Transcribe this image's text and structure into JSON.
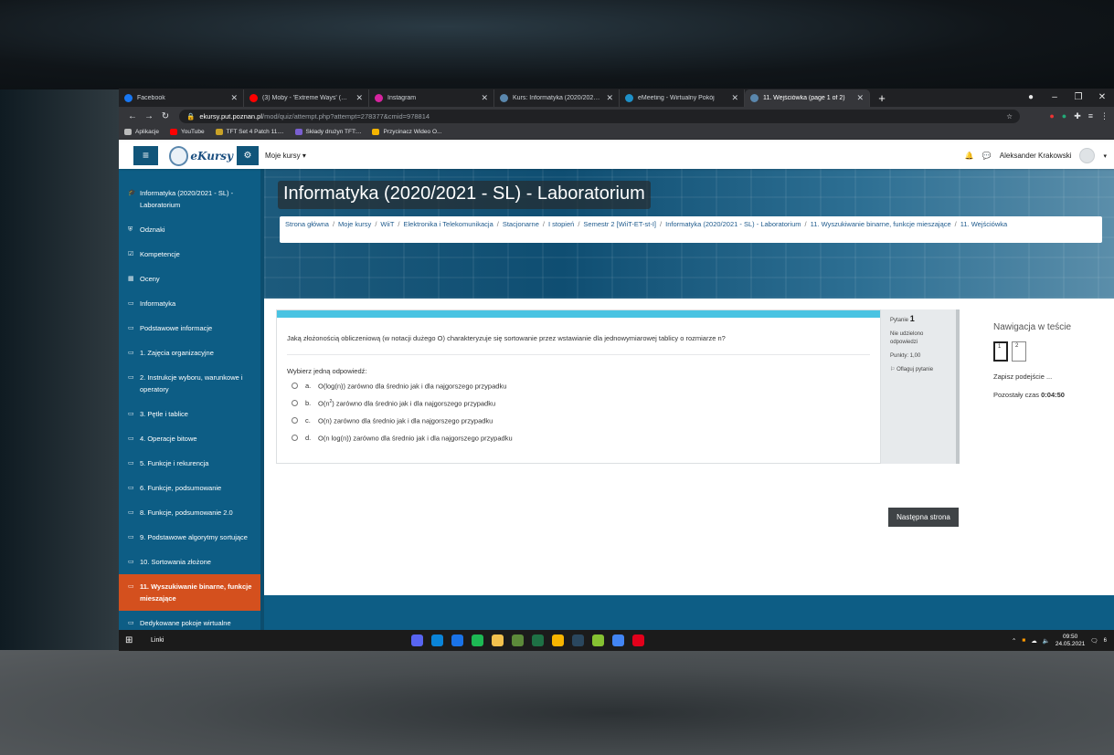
{
  "tabs": [
    {
      "title": "Facebook",
      "color": "#1877f2"
    },
    {
      "title": "(3) Moby - 'Extreme Ways' (Offici",
      "color": "#ff0000"
    },
    {
      "title": "Instagram",
      "color": "#d6249f"
    },
    {
      "title": "Kurs: Informatyka (2020/2021 - S",
      "color": "#5a87ad"
    },
    {
      "title": "eMeeting - Wirtualny Pokój",
      "color": "#1e90c8"
    },
    {
      "title": "11. Wejściówka (page 1 of 2)",
      "color": "#5a87ad"
    }
  ],
  "address": {
    "host": "ekursy.put.poznan.pl",
    "path": "/mod/quiz/attempt.php?attempt=278377&cmid=978814"
  },
  "bookmarks": [
    {
      "label": "Aplikacje",
      "color": "#bbbbbb"
    },
    {
      "label": "YouTube",
      "color": "#ff0000"
    },
    {
      "label": "TFT Set 4 Patch 11....",
      "color": "#c9a227"
    },
    {
      "label": "Składy drużyn TFT:...",
      "color": "#7a5fd1"
    },
    {
      "label": "Przycinacz Wideo O...",
      "color": "#f4b400"
    }
  ],
  "navbar": {
    "logo_text": "eKursy",
    "my_courses": "Moje kursy ▾",
    "user_name": "Aleksander Krakowski"
  },
  "sidebar": {
    "items": [
      {
        "icon": "graduation-cap-icon",
        "glyph": "🎓",
        "label": "Informatyka (2020/2021 - SL) - Laboratorium"
      },
      {
        "icon": "shield-icon",
        "glyph": "⛨",
        "label": "Odznaki"
      },
      {
        "icon": "checkbox-icon",
        "glyph": "☑",
        "label": "Kompetencje"
      },
      {
        "icon": "table-icon",
        "glyph": "▦",
        "label": "Oceny"
      },
      {
        "icon": "folder-icon",
        "glyph": "▭",
        "label": "Informatyka"
      },
      {
        "icon": "folder-icon",
        "glyph": "▭",
        "label": "Podstawowe informacje"
      },
      {
        "icon": "folder-icon",
        "glyph": "▭",
        "label": "1. Zajęcia organizacyjne"
      },
      {
        "icon": "folder-icon",
        "glyph": "▭",
        "label": "2. Instrukcje wyboru, warunkowe i operatory"
      },
      {
        "icon": "folder-icon",
        "glyph": "▭",
        "label": "3. Pętle i tablice"
      },
      {
        "icon": "folder-icon",
        "glyph": "▭",
        "label": "4. Operacje bitowe"
      },
      {
        "icon": "folder-icon",
        "glyph": "▭",
        "label": "5. Funkcje i rekurencja"
      },
      {
        "icon": "folder-icon",
        "glyph": "▭",
        "label": "6. Funkcje, podsumowanie"
      },
      {
        "icon": "folder-icon",
        "glyph": "▭",
        "label": "8. Funkcje, podsumowanie 2.0"
      },
      {
        "icon": "folder-icon",
        "glyph": "▭",
        "label": "9. Podstawowe algorytmy sortujące"
      },
      {
        "icon": "folder-icon",
        "glyph": "▭",
        "label": "10. Sortowania złożone"
      },
      {
        "icon": "folder-icon",
        "glyph": "▭",
        "label": "11. Wyszukiwanie binarne, funkcje mieszające"
      },
      {
        "icon": "folder-icon",
        "glyph": "▭",
        "label": "Dedykowane pokoje wirtualne"
      }
    ]
  },
  "course_title": "Informatyka (2020/2021 - SL) - Laboratorium",
  "breadcrumb": [
    "Strona główna",
    "Moje kursy",
    "WiiT",
    "Elektronika i Telekomunikacja",
    "Stacjonarne",
    "I stopień",
    "Semestr 2 [WiiT-ET-st-I]",
    "Informatyka (2020/2021 - SL) - Laboratorium",
    "11. Wyszukiwanie binarne, funkcje mieszające",
    "11. Wejściówka"
  ],
  "question": {
    "text": "Jaką złożonością obliczeniową (w notacji dużego O) charakteryzuje się sortowanie przez wstawianie dla jednowymiarowej tablicy o rozmiarze n?",
    "prompt": "Wybierz jedną odpowiedź:",
    "options": [
      {
        "letter": "a.",
        "pre": "O(log(n))",
        "sup": "",
        "post": " zarówno dla średnio jak i dla najgorszego przypadku"
      },
      {
        "letter": "b.",
        "pre": "O(n",
        "sup": "2",
        "post": ") zarówno dla średnio jak i dla najgorszego przypadku"
      },
      {
        "letter": "c.",
        "pre": "O(n)",
        "sup": "",
        "post": " zarówno dla średnio jak i dla najgorszego przypadku"
      },
      {
        "letter": "d.",
        "pre": "O(n log(n))",
        "sup": "",
        "post": " zarówno dla średnio jak i dla najgorszego przypadku"
      }
    ]
  },
  "qinfo": {
    "label": "Pytanie",
    "number": "1",
    "status": "Nie udzielono odpowiedzi",
    "points": "Punkty: 1,00",
    "flag": "Oflaguj pytanie"
  },
  "quiz_nav": {
    "title": "Nawigacja w teście",
    "buttons": [
      "1",
      "2"
    ],
    "save_link": "Zapisz podejście ...",
    "timer_label": "Pozostały czas",
    "timer_value": "0:04:50"
  },
  "next_button": "Następna strona",
  "taskbar": {
    "search": "Linki",
    "apps": [
      "#5865f2",
      "#0a84d8",
      "#1a73e8",
      "#1db954",
      "#f2c14e",
      "#5c8a3a",
      "#1e7145",
      "#f7b500",
      "#2a475e",
      "#86c232",
      "#4285f4",
      "#e3001b"
    ],
    "time": "09:50",
    "date": "24.05.2021",
    "notif_count": "6"
  }
}
